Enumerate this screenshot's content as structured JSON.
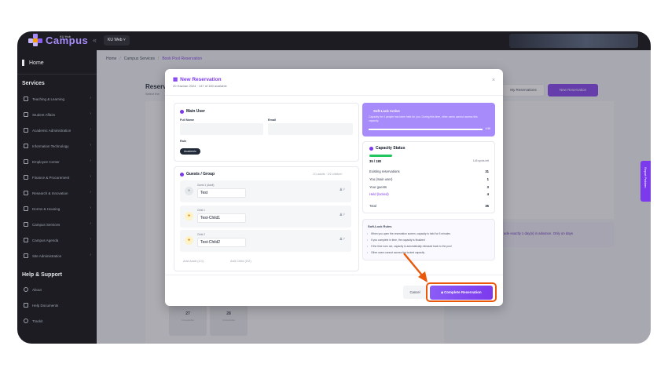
{
  "topbar": {
    "logo_text": "Campus",
    "logo_sup": "KU Hub",
    "collapse_icon": "chevron-left-icon",
    "workspace": "KU Web ˅"
  },
  "sidebar": {
    "home": "Home",
    "services_title": "Services",
    "items": [
      {
        "label": "Teaching & Learning",
        "icon": "pen-icon"
      },
      {
        "label": "Student Affairs",
        "icon": "id-card-icon"
      },
      {
        "label": "Academic Administration",
        "icon": "list-icon"
      },
      {
        "label": "Information Technology",
        "icon": "tools-icon"
      },
      {
        "label": "Employee Center",
        "icon": "briefcase-icon"
      },
      {
        "label": "Finance & Procurement",
        "icon": "calculator-icon"
      },
      {
        "label": "Research & Innovation",
        "icon": "search-icon"
      },
      {
        "label": "Dorms & Housing",
        "icon": "home-icon"
      },
      {
        "label": "Campus Services",
        "icon": "building-icon"
      },
      {
        "label": "Campus Agenda",
        "icon": "calendar-icon"
      },
      {
        "label": "Site Administration",
        "icon": "user-gear-icon"
      }
    ],
    "help_title": "Help & Support",
    "help_items": [
      {
        "label": "About",
        "icon": "info-icon"
      },
      {
        "label": "Help Documents",
        "icon": "document-icon"
      },
      {
        "label": "Trackit",
        "icon": "gear-icon"
      }
    ]
  },
  "breadcrumb": {
    "home": "Home",
    "sep": "/",
    "parent": "Campus Services",
    "current": "Book Pool Reservation"
  },
  "page": {
    "title_partial": "Reserv",
    "subtitle_partial": "Select the",
    "my_reservations": "My Reservations",
    "new_reservation": "New Reservation",
    "notice_partial": "ade exactly 1 day(s) in advance. Only on days",
    "report_tab": "Report Problem",
    "calendar_cells": [
      {
        "day": "27",
        "label": "Unavailable"
      },
      {
        "day": "28",
        "label": "Unavailable"
      }
    ]
  },
  "modal": {
    "title": "New Reservation",
    "subtitle": "20 Haziran 2024 · 147 of 180 available",
    "main_user": {
      "title": "Main User",
      "full_name_label": "Full Name",
      "email_label": "Email",
      "role_label": "Role",
      "role_badge": "Academic"
    },
    "guests": {
      "title": "Guests / Group",
      "count_hint": "1/1 adults · 2/2 children",
      "rows": [
        {
          "label": "Guest 1 (Adult)",
          "value": "Test",
          "type": "adult"
        },
        {
          "label": "Child 1",
          "value": "Test-Child1",
          "type": "child"
        },
        {
          "label": "Child 2",
          "value": "Test-Child2",
          "type": "child"
        }
      ],
      "add_adult": "Add Adult (1/1)",
      "add_child": "Add Child (2/2)"
    },
    "lock": {
      "title": "Soft-Lock Active",
      "desc": "Capacity for 4 people has been held for you. During this time, other users cannot access this capacity.",
      "timer": "4:58",
      "progress": 1.0
    },
    "capacity": {
      "title": "Capacity Status",
      "used": "35 / 180",
      "spots_left": "145 spots left",
      "fill": 0.19,
      "rows": [
        {
          "label": "Existing reservations",
          "value": "31"
        },
        {
          "label": "You (main user)",
          "value": "1"
        },
        {
          "label": "Your guests",
          "value": "3"
        },
        {
          "label": "Held (locked)",
          "value": "4"
        }
      ],
      "total_label": "Total",
      "total_value": "35"
    },
    "rules": {
      "title": "Soft-Lock Rules",
      "items": [
        "When you open the reservation screen, capacity is held for 5 minutes",
        "If you complete in time, the capacity is finalized",
        "If the time runs out, capacity is automatically released back to the pool",
        "Other users cannot access the locked capacity"
      ]
    },
    "cancel": "Cancel",
    "complete": "Complete Reservation"
  },
  "colors": {
    "accent": "#7c3aed",
    "sidebar": "#1c1c22",
    "highlight": "#ea580c"
  }
}
